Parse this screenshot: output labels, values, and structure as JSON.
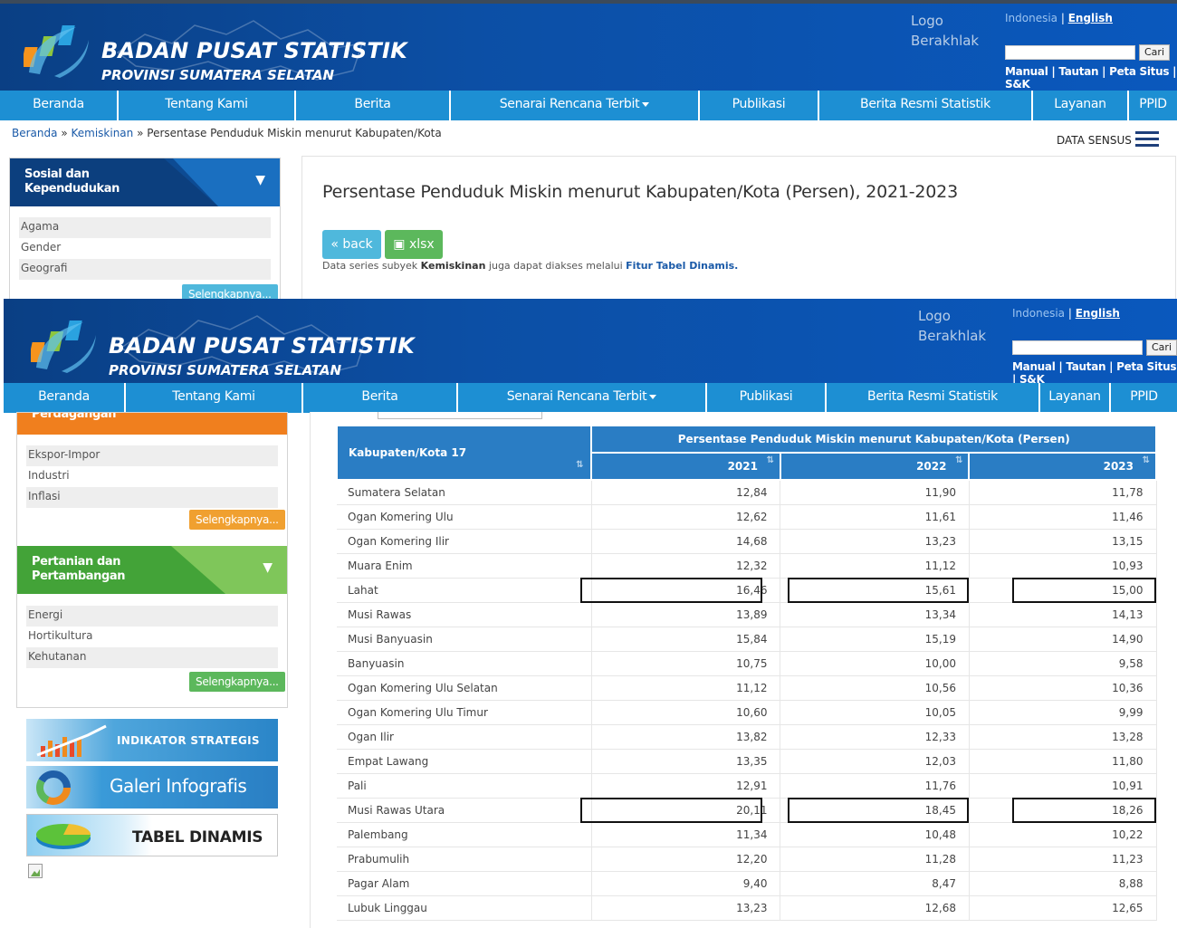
{
  "site": {
    "title": "BADAN PUSAT STATISTIK",
    "subtitle": "PROVINSI SUMATERA SELATAN",
    "berakhlak_alt": "Logo Berakhlak",
    "lang_id": "Indonesia",
    "lang_en": "English",
    "search_button": "Cari",
    "search_placeholder": "",
    "toplinks": "Manual | Tautan | Peta Situs | S&K"
  },
  "nav": [
    {
      "label": "Beranda"
    },
    {
      "label": "Tentang Kami"
    },
    {
      "label": "Berita"
    },
    {
      "label": "Senarai Rencana Terbit",
      "has_dropdown": true
    },
    {
      "label": "Publikasi"
    },
    {
      "label": "Berita Resmi Statistik"
    },
    {
      "label": "Layanan"
    },
    {
      "label": "PPID"
    }
  ],
  "breadcrumb": {
    "home": "Beranda",
    "sep": "»",
    "category": "Kemiskinan",
    "current": "Persentase Penduduk Miskin menurut Kabupaten/Kota"
  },
  "data_sensus": "DATA SENSUS",
  "sidebar_top": {
    "category": "Sosial dan Kependudukan",
    "items": [
      "Agama",
      "Gender",
      "Geografi"
    ],
    "more": "Selengkapnya..."
  },
  "content": {
    "title": "Persentase Penduduk Miskin menurut Kabupaten/Kota (Persen), 2021-2023",
    "back_label": "back",
    "xlsx_label": "xlsx",
    "note_prefix": "Data series subyek",
    "note_subject": "Kemiskinan",
    "note_middle": "juga dapat diakses melalui",
    "note_link": "Fitur Tabel Dinamis."
  },
  "sidebar_bottom": {
    "cut_category": "Perdagangan",
    "trade_items": [
      "Ekspor-Impor",
      "Industri",
      "Inflasi"
    ],
    "trade_more": "Selengkapnya...",
    "agri_category": "Pertanian dan Pertambangan",
    "agri_items": [
      "Energi",
      "Hortikultura",
      "Kehutanan"
    ],
    "agri_more": "Selengkapnya...",
    "banners": [
      "INDIKATOR STRATEGIS",
      "Galeri Infografis",
      "TABEL DINAMIS"
    ]
  },
  "table": {
    "row_header": "Kabupaten/Kota 17",
    "group_header": "Persentase Penduduk Miskin menurut Kabupaten/Kota (Persen)",
    "years": [
      "2021",
      "2022",
      "2023"
    ],
    "rows": [
      {
        "name": "Sumatera Selatan",
        "values": [
          "12,84",
          "11,90",
          "11,78"
        ]
      },
      {
        "name": "Ogan Komering Ulu",
        "values": [
          "12,62",
          "11,61",
          "11,46"
        ]
      },
      {
        "name": "Ogan Komering Ilir",
        "values": [
          "14,68",
          "13,23",
          "13,15"
        ]
      },
      {
        "name": "Muara Enim",
        "values": [
          "12,32",
          "11,12",
          "10,93"
        ]
      },
      {
        "name": "Lahat",
        "values": [
          "16,46",
          "15,61",
          "15,00"
        ],
        "highlight": true
      },
      {
        "name": "Musi Rawas",
        "values": [
          "13,89",
          "13,34",
          "14,13"
        ]
      },
      {
        "name": "Musi Banyuasin",
        "values": [
          "15,84",
          "15,19",
          "14,90"
        ]
      },
      {
        "name": "Banyuasin",
        "values": [
          "10,75",
          "10,00",
          "9,58"
        ]
      },
      {
        "name": "Ogan Komering Ulu Selatan",
        "values": [
          "11,12",
          "10,56",
          "10,36"
        ]
      },
      {
        "name": "Ogan Komering Ulu Timur",
        "values": [
          "10,60",
          "10,05",
          "9,99"
        ]
      },
      {
        "name": "Ogan Ilir",
        "values": [
          "13,82",
          "12,33",
          "13,28"
        ]
      },
      {
        "name": "Empat Lawang",
        "values": [
          "13,35",
          "12,03",
          "11,80"
        ]
      },
      {
        "name": "Pali",
        "values": [
          "12,91",
          "11,76",
          "10,91"
        ]
      },
      {
        "name": "Musi Rawas Utara",
        "values": [
          "20,11",
          "18,45",
          "18,26"
        ],
        "highlight": true
      },
      {
        "name": "Palembang",
        "values": [
          "11,34",
          "10,48",
          "10,22"
        ]
      },
      {
        "name": "Prabumulih",
        "values": [
          "12,20",
          "11,28",
          "11,23"
        ]
      },
      {
        "name": "Pagar Alam",
        "values": [
          "9,40",
          "8,47",
          "8,88"
        ]
      },
      {
        "name": "Lubuk Linggau",
        "values": [
          "13,23",
          "12,68",
          "12,65"
        ]
      }
    ]
  },
  "colors": {
    "header_blue": "#0c4fa5",
    "nav_blue": "#1d8fd3",
    "table_header": "#2a7dc4",
    "btn_back": "#4fb8dc",
    "btn_xlsx": "#5cb85c",
    "more_orange": "#f0a030",
    "more_green": "#5cb85c",
    "more_blue": "#4fb8dc"
  }
}
